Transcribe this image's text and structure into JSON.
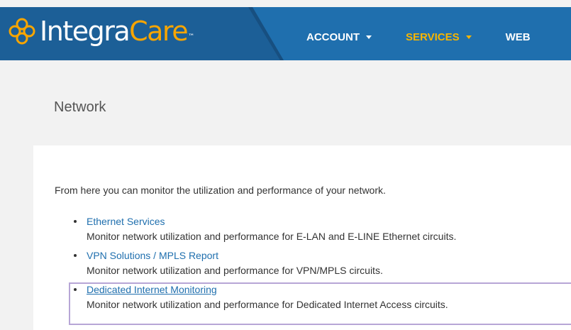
{
  "brand": {
    "name_part1": "Integra",
    "name_part2": "Care",
    "trademark": "™",
    "colors": {
      "header_blue": "#1f6fae",
      "logo_panel": "#1c5f97",
      "accent_orange": "#f7a500",
      "link_blue": "#1f6fae"
    }
  },
  "nav": {
    "items": [
      {
        "label": "ACCOUNT",
        "active": false
      },
      {
        "label": "SERVICES",
        "active": true
      },
      {
        "label": "WEB",
        "active": false
      }
    ]
  },
  "page": {
    "title": "Network",
    "intro": "From here you can monitor the utilization and performance of your network."
  },
  "services": [
    {
      "link": "Ethernet Services",
      "description": "Monitor network utilization and performance for E-LAN and E-LINE Ethernet circuits."
    },
    {
      "link": "VPN Solutions / MPLS Report",
      "description": "Monitor network utilization and performance for VPN/MPLS circuits."
    },
    {
      "link": "Dedicated Internet Monitoring",
      "description": "Monitor network utilization and performance for Dedicated Internet Access circuits."
    }
  ],
  "icons": {
    "logo": "integracare-flower-icon",
    "nav_caret": "caret-down-icon",
    "bullet": "bullet-icon"
  }
}
